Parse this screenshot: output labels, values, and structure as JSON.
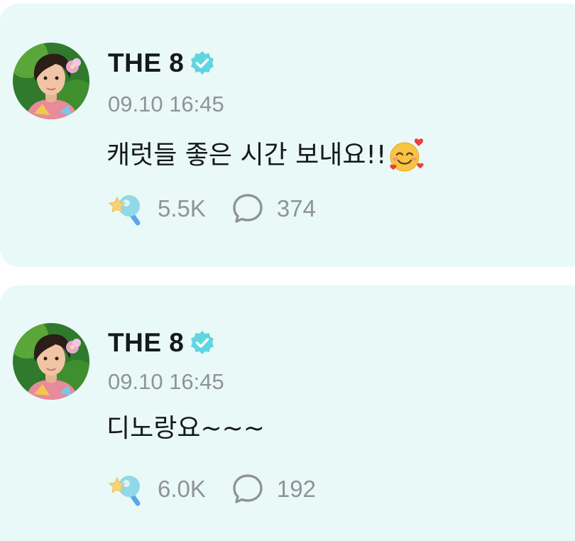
{
  "posts": [
    {
      "author": "THE 8",
      "verified": true,
      "timestamp": "09.10 16:45",
      "text": "캐럿들 좋은 시간 보내요!!",
      "emoji": "smiling-face-with-hearts",
      "likes": "5.5K",
      "comments": "374"
    },
    {
      "author": "THE 8",
      "verified": true,
      "timestamp": "09.10 16:45",
      "text": "디노랑요~~~",
      "likes": "6.0K",
      "comments": "192"
    }
  ],
  "colors": {
    "card_background": "#e9f9f7",
    "verified_badge": "#5fd6e0",
    "meta_text": "#8e9399"
  },
  "icons": [
    "verified-badge-icon",
    "light-stick-icon",
    "comment-bubble-icon"
  ]
}
